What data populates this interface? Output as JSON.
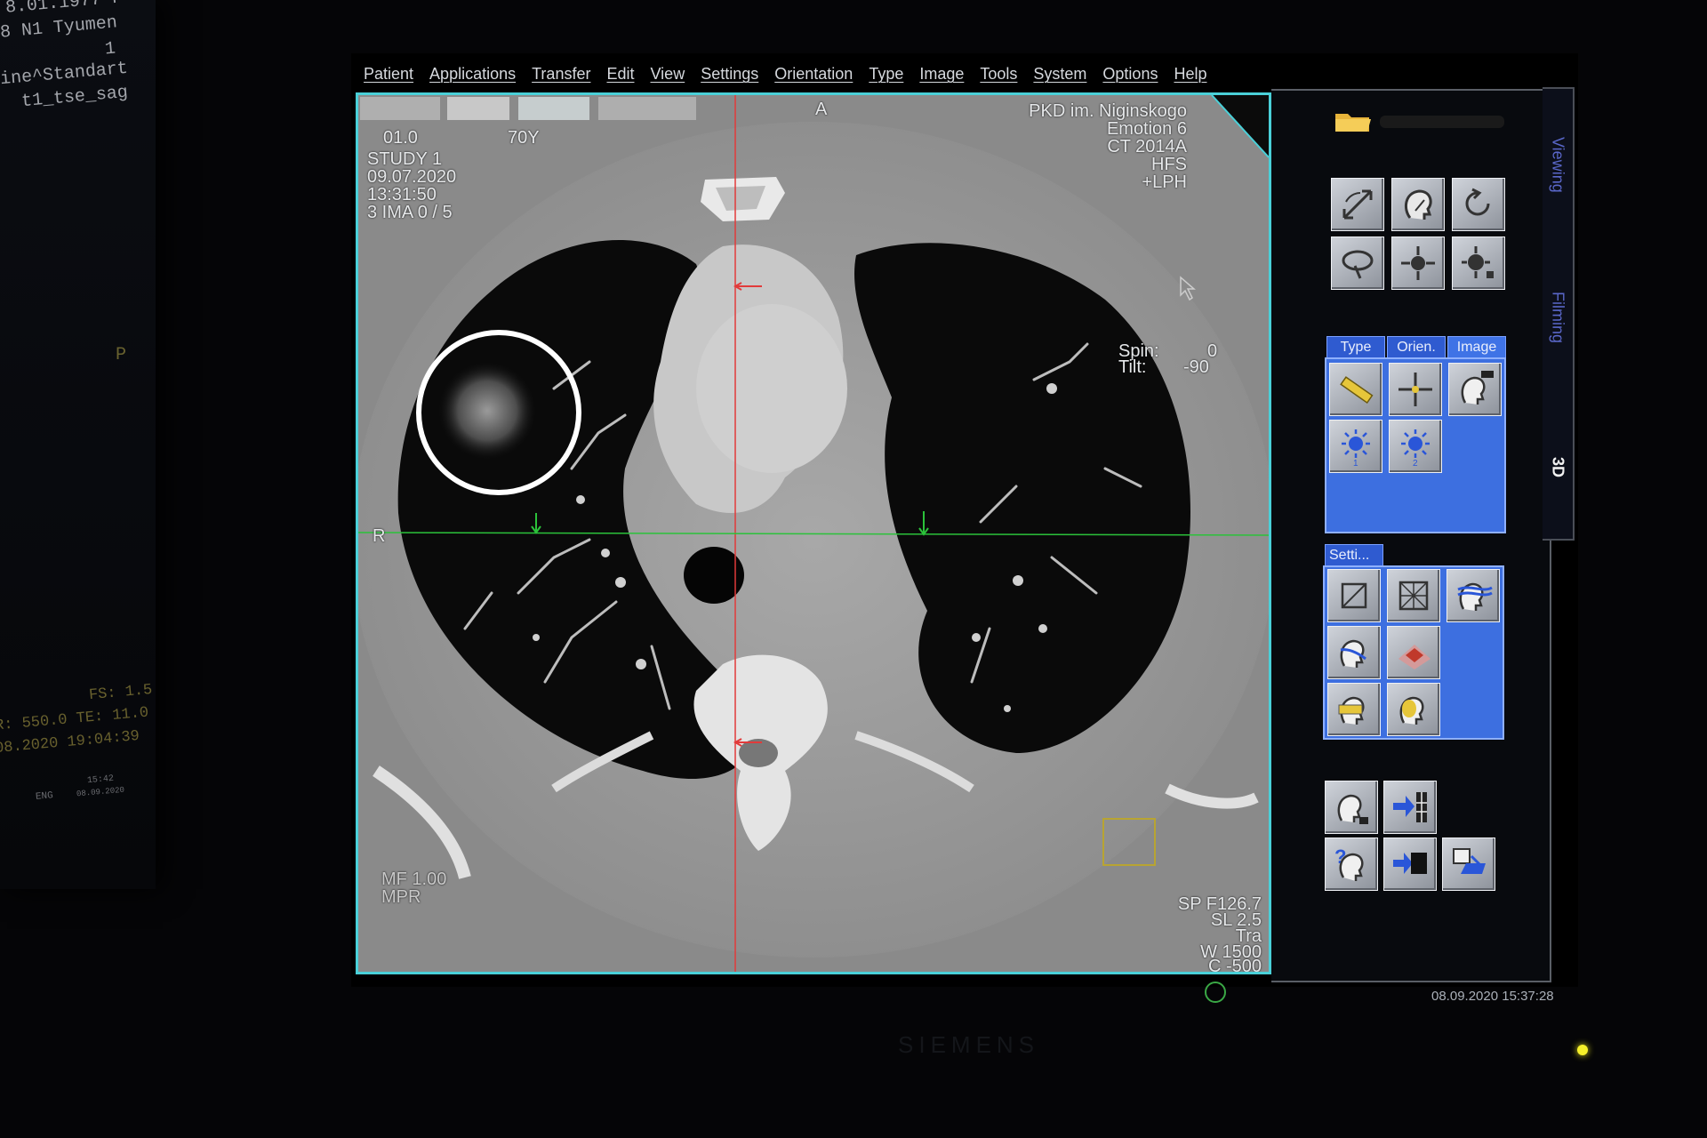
{
  "left_monitor": {
    "lines": [
      "8.01.1977 F",
      "8 N1 Tyumen",
      "1",
      "ine^Standart",
      "t1_tse_sag"
    ],
    "marker": "P",
    "params": [
      "FS: 1.5",
      "R: 550.0 TE: 11.0",
      "08.2020 19:04:39"
    ],
    "taskbar": "ENG",
    "taskbar_time": "15:42",
    "taskbar_date": "08.09.2020"
  },
  "menu": [
    "Patient",
    "Applications",
    "Transfer",
    "Edit",
    "View",
    "Settings",
    "Orientation",
    "Type",
    "Image",
    "Tools",
    "System",
    "Options",
    "Help"
  ],
  "viewport": {
    "top_left": [
      "STUDY 1",
      "09.07.2020",
      "13:31:50",
      "3 IMA 0 / 5"
    ],
    "age_partial": "70Y",
    "id_partial": "01.0",
    "top_right": [
      "PKD im. Niginskogo",
      "Emotion 6",
      "CT 2014A",
      "HFS",
      "+LPH"
    ],
    "orientation_top": "A",
    "orientation_left": "R",
    "spin_label": "Spin:",
    "spin_value": "0",
    "tilt_label": "Tilt:",
    "tilt_value": "-90",
    "bottom_left": [
      "MF 1.00",
      "MPR"
    ],
    "bottom_right": [
      "SP F126.7",
      "SL 2.5",
      "Tra",
      "W 1500",
      "C -500"
    ]
  },
  "side_tabs": [
    "Viewing",
    "Filming",
    "3D"
  ],
  "cards": {
    "type_tabs": [
      "Type",
      "Orien.",
      "Image"
    ],
    "settings_tab": "Setti..."
  },
  "timestamp": "08.09.2020 15:37:28",
  "brand": "SIEMENS",
  "colors": {
    "viewport_border": "#4ad0d8",
    "card_blue": "#3d6fe0",
    "crosshair_red": "#e23a3a",
    "crosshair_green": "#2bc23a",
    "highlight_circle": "#ffffff"
  }
}
